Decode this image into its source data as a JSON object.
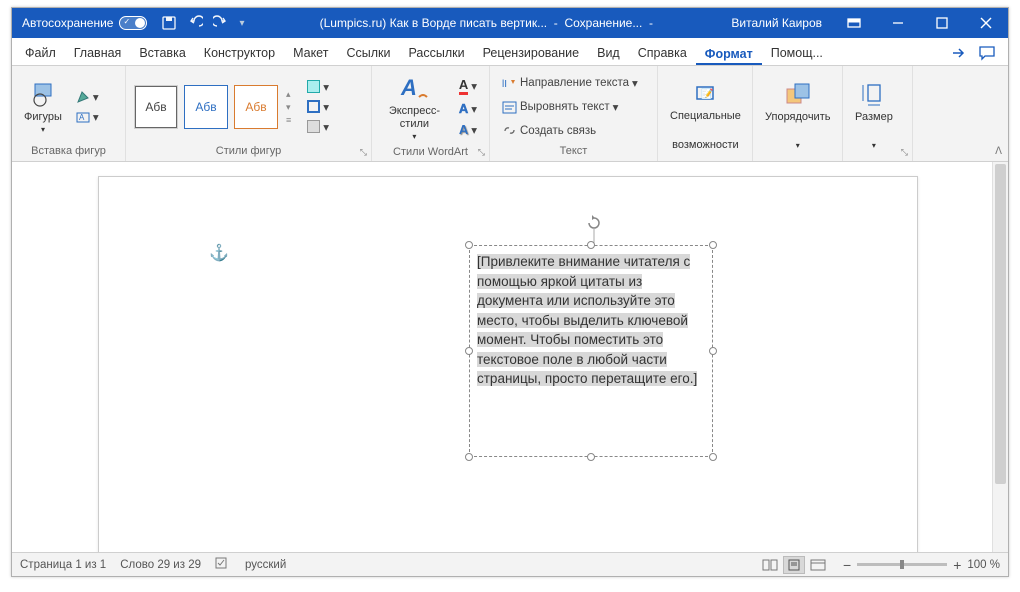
{
  "titlebar": {
    "autosave": "Автосохранение",
    "doc_title": "(Lumpics.ru) Как в Ворде писать вертик...",
    "saving": "Сохранение...",
    "user": "Виталий Каиров"
  },
  "tabs": [
    "Файл",
    "Главная",
    "Вставка",
    "Конструктор",
    "Макет",
    "Ссылки",
    "Рассылки",
    "Рецензирование",
    "Вид",
    "Справка",
    "Формат",
    "Помощ..."
  ],
  "active_tab": 10,
  "ribbon": {
    "shapes": {
      "label": "Вставка фигур",
      "btn": "Фигуры"
    },
    "styles": {
      "label": "Стили фигур",
      "sample": "Абв"
    },
    "wordart": {
      "label": "Стили WordArt",
      "btn": "Экспресс-стили"
    },
    "text": {
      "label": "Текст",
      "direction": "Направление текста",
      "align": "Выровнять текст",
      "link": "Создать связь"
    },
    "access": {
      "btn_line1": "Специальные",
      "btn_line2": "возможности"
    },
    "arrange": {
      "btn": "Упорядочить"
    },
    "size": {
      "btn": "Размер"
    }
  },
  "textbox_text": "[Привлеките внимание читателя с помощью яркой цитаты из документа или используйте это место, чтобы выделить ключевой момент. Чтобы поместить это текстовое поле в любой части страницы, просто перетащите его.]",
  "statusbar": {
    "page": "Страница 1 из 1",
    "words": "Слово 29 из 29",
    "lang": "русский",
    "zoom": "100 %"
  }
}
